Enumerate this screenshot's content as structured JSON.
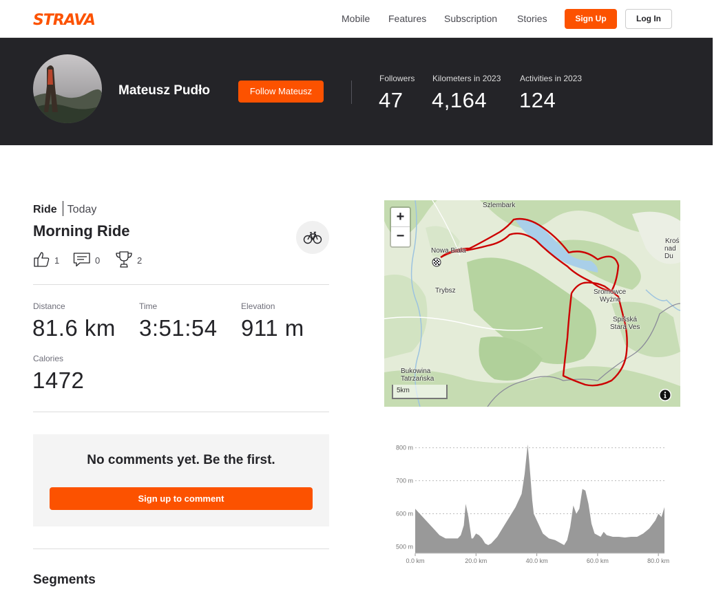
{
  "brand": {
    "logo_text": "STRAVA",
    "accent": "#fc5200"
  },
  "nav": {
    "links": [
      "Mobile",
      "Features",
      "Subscription",
      "Stories"
    ],
    "signup_label": "Sign Up",
    "login_label": "Log In"
  },
  "athlete": {
    "name": "Mateusz Pudło",
    "follow_label": "Follow Mateusz",
    "stats": [
      {
        "label": "Followers",
        "value": "47"
      },
      {
        "label": "Kilometers in 2023",
        "value": "4,164"
      },
      {
        "label": "Activities in 2023",
        "value": "124"
      }
    ]
  },
  "activity": {
    "type": "Ride",
    "date": "Today",
    "title": "Morning Ride",
    "sport_icon": "bike-icon",
    "kudos_count": "1",
    "comment_count": "0",
    "achievement_count": "2",
    "metrics": [
      {
        "label": "Distance",
        "value": "81.6 km"
      },
      {
        "label": "Time",
        "value": "3:51:54"
      },
      {
        "label": "Elevation",
        "value": "911 m"
      },
      {
        "label": "Calories",
        "value": "1472"
      }
    ]
  },
  "comments": {
    "empty_text": "No comments yet. Be the first.",
    "signup_label": "Sign up to comment"
  },
  "segments": {
    "heading": "Segments"
  },
  "map": {
    "zoom_in": "+",
    "zoom_out": "−",
    "scale_label": "5km",
    "places": {
      "szlembark": "Szlembark",
      "nowa_biala": "Nowa Biała",
      "trybsz": "Trybsz",
      "sromowce_1": "Sromowce",
      "sromowce_2": "Wyżne",
      "spisska_1": "Spišská",
      "spisska_2": "Stará Ves",
      "bukowina_1": "Bukowina",
      "bukowina_2": "Tatrzańska",
      "kros_1": "Kroś",
      "kros_2": "nad Du"
    },
    "route_color": "#cc0000"
  },
  "chart_data": {
    "type": "area",
    "title": "",
    "xlabel": "",
    "ylabel": "",
    "xlim": [
      0,
      82
    ],
    "ylim": [
      480,
      820
    ],
    "x_ticks": [
      0,
      20,
      40,
      60,
      80
    ],
    "x_tick_labels": [
      "0.0 km",
      "20.0 km",
      "40.0 km",
      "60.0 km",
      "80.0 km"
    ],
    "y_ticks": [
      500,
      600,
      700,
      800
    ],
    "y_tick_labels": [
      "500 m",
      "600 m",
      "700 m",
      "800 m"
    ],
    "grid": true,
    "fill_color": "#999999",
    "series": [
      {
        "x": [
          0,
          1,
          2,
          4,
          6,
          8,
          10,
          12,
          14,
          15,
          16,
          16.6,
          17.5,
          18.5,
          19,
          20,
          21,
          22,
          23,
          24,
          25,
          27,
          29,
          31,
          33,
          35,
          36,
          37,
          37.5,
          38,
          38.5,
          39,
          40,
          41,
          42,
          44,
          46,
          48,
          49,
          50,
          51,
          52,
          53,
          54,
          55,
          56,
          57,
          58,
          59,
          60,
          61,
          62,
          63,
          65,
          67,
          69,
          71,
          73,
          75,
          77,
          79,
          80,
          81,
          82
        ],
        "y": [
          615,
          605,
          595,
          575,
          555,
          535,
          525,
          525,
          525,
          535,
          565,
          630,
          590,
          525,
          525,
          540,
          535,
          525,
          510,
          505,
          510,
          530,
          560,
          590,
          620,
          660,
          720,
          810,
          760,
          700,
          640,
          600,
          580,
          560,
          540,
          525,
          520,
          510,
          505,
          520,
          560,
          625,
          600,
          615,
          675,
          670,
          630,
          570,
          540,
          535,
          530,
          545,
          535,
          530,
          530,
          528,
          530,
          530,
          540,
          555,
          580,
          600,
          590,
          620
        ]
      }
    ]
  }
}
